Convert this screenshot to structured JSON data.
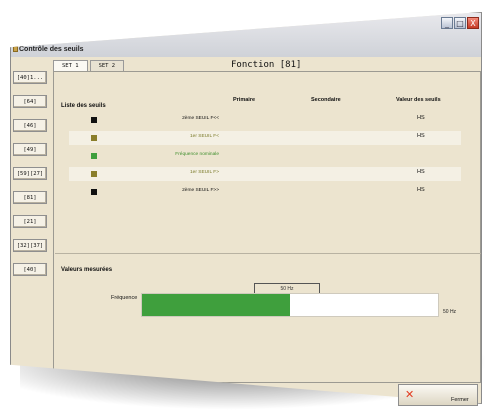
{
  "window": {
    "title": "Contrôle des seuils",
    "controls": [
      "_",
      "□",
      "X"
    ]
  },
  "nav": {
    "items": [
      "[40]1...",
      "[64]",
      "[46]",
      "[49]",
      "[59][27]",
      "[81]",
      "[21]",
      "[32][37]",
      "[40]"
    ]
  },
  "tabs": [
    {
      "label": "SET 1",
      "active": true
    },
    {
      "label": "SET 2",
      "active": false
    }
  ],
  "fonction": "Fonction [81]",
  "liste": {
    "heading": "Liste des seuils",
    "columns": {
      "primaire": "Primaire",
      "secondaire": "Secondaire",
      "valeur": "Valeur des seuils"
    },
    "rows": [
      {
        "label": "2ème SEUIL F<<",
        "value": "HS",
        "color": "#111111",
        "label_color": "#111111"
      },
      {
        "label": "1er SEUIL F<",
        "value": "HS",
        "color": "#8a7e2a",
        "label_color": "#7a7a28"
      },
      {
        "label": "Fréquence nominale",
        "value": "",
        "color": "#3f9f3d",
        "label_color": "#3f8f2d"
      },
      {
        "label": "1er SEUIL F>",
        "value": "HS",
        "color": "#8a7e2a",
        "label_color": "#7a7a28"
      },
      {
        "label": "2ème SEUIL F>>",
        "value": "HS",
        "color": "#111111",
        "label_color": "#111111"
      }
    ]
  },
  "mesures": {
    "heading": "Valeurs mesurées",
    "current_value": "50 Hz",
    "label": "Fréquence",
    "fill_fraction": 0.5,
    "max_label": "50 Hz",
    "fill_color": "#3f9f3d"
  },
  "footer": {
    "close_label": "Fermer"
  }
}
